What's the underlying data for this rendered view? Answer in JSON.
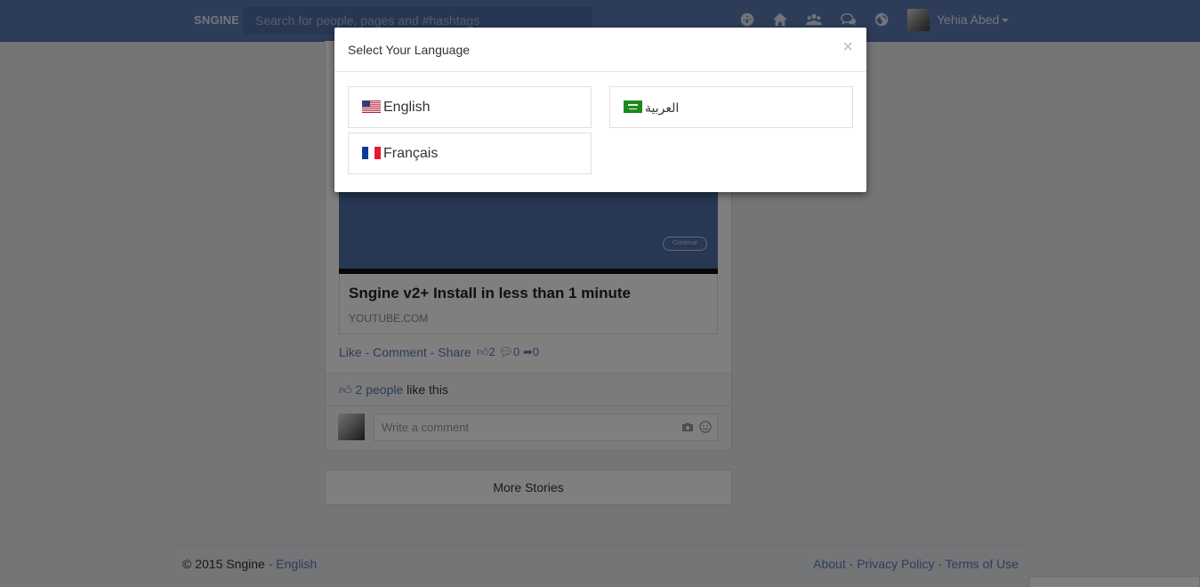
{
  "navbar": {
    "brand": "SNGINE",
    "search_placeholder": "Search for people, pages and #hashtags",
    "icons": [
      "dashboard-icon",
      "home-icon",
      "friends-icon",
      "messages-icon",
      "notifications-globe-icon"
    ],
    "user_name": "Yehia Abed"
  },
  "post": {
    "video_button": "Continue",
    "link_title": "Sngine v2+ Install in less than 1 minute",
    "link_domain": "YOUTUBE.COM",
    "actions": {
      "like": "Like",
      "sep1": " - ",
      "comment": "Comment",
      "sep2": " - ",
      "share": "Share"
    },
    "stats": {
      "likes": "2",
      "comments": "0",
      "shares": "0"
    },
    "likes_count_text": "2 people",
    "likes_suffix": " like this",
    "comment_placeholder": "Write a comment"
  },
  "more_stories": "More Stories",
  "footer": {
    "copyright": "© 2015 Sngine · ",
    "language": "English",
    "about": "About",
    "sep": " · ",
    "privacy": "Privacy Policy",
    "terms": "Terms of Use"
  },
  "modal": {
    "title": "Select Your Language",
    "close": "×",
    "languages": [
      {
        "label": "English",
        "flag": "us-flag"
      },
      {
        "label": "العربية",
        "flag": "sa-flag"
      },
      {
        "label": "Français",
        "flag": "fr-flag"
      }
    ]
  },
  "colors": {
    "navbar": "#5b7bb3",
    "link": "#5b7bb3",
    "overlay": "rgba(0,0,0,0.5)"
  }
}
